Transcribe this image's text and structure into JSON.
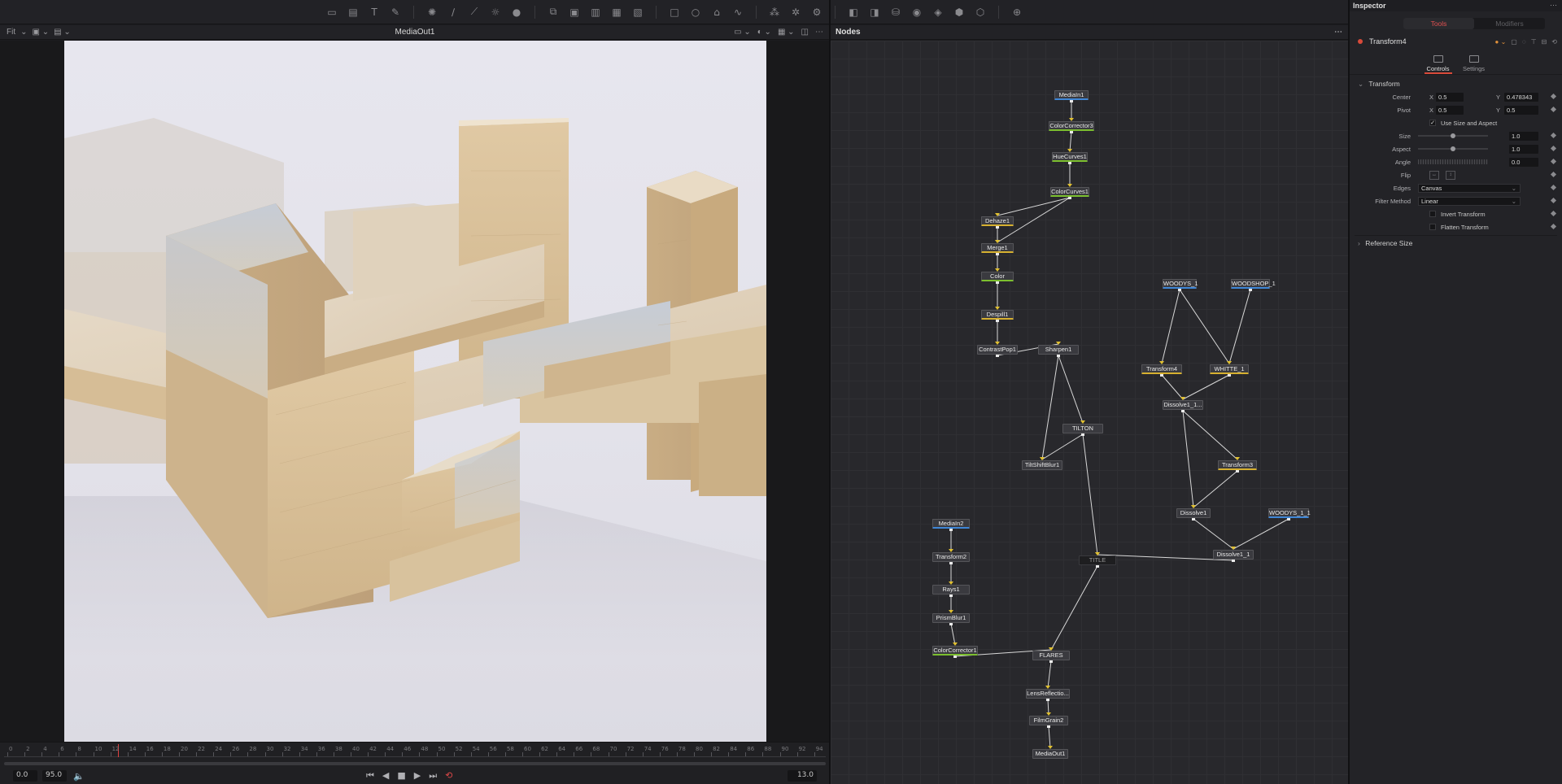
{
  "viewer": {
    "fit_label": "Fit",
    "title": "MediaOut1"
  },
  "timeline": {
    "ticks": [
      "0",
      "2",
      "4",
      "6",
      "8",
      "10",
      "12",
      "14",
      "16",
      "18",
      "20",
      "22",
      "24",
      "26",
      "28",
      "30",
      "32",
      "34",
      "36",
      "38",
      "40",
      "42",
      "44",
      "46",
      "48",
      "50",
      "52",
      "54",
      "56",
      "58",
      "60",
      "62",
      "64",
      "66",
      "68",
      "70",
      "72",
      "74",
      "76",
      "78",
      "80",
      "82",
      "84",
      "86",
      "88",
      "90",
      "92",
      "94"
    ],
    "start": "0.0",
    "end": "95.0",
    "current_frame": "13.0"
  },
  "nodes_panel": {
    "title": "Nodes",
    "nodes": [
      {
        "id": "MediaIn1",
        "label": "MediaIn1"
      },
      {
        "id": "ColorCorrector3",
        "label": "ColorCorrector3"
      },
      {
        "id": "HueCurves1",
        "label": "HueCurves1"
      },
      {
        "id": "ColorCurves1",
        "label": "ColorCurves1"
      },
      {
        "id": "Dehaze1",
        "label": "Dehaze1"
      },
      {
        "id": "Merge1",
        "label": "Merge1"
      },
      {
        "id": "Color",
        "label": "Color"
      },
      {
        "id": "Despill1",
        "label": "Despill1"
      },
      {
        "id": "ContrastPop1",
        "label": "ContrastPop1"
      },
      {
        "id": "Sharpen1",
        "label": "Sharpen1"
      },
      {
        "id": "TILTON",
        "label": "TILTON"
      },
      {
        "id": "TiltShiftBlur1",
        "label": "TiltShiftBlur1"
      },
      {
        "id": "WOODYS_1",
        "label": "WOODYS_1"
      },
      {
        "id": "WOODSHOP_1",
        "label": "WOODSHOP_1"
      },
      {
        "id": "Transform4",
        "label": "Transform4"
      },
      {
        "id": "WHITTE_1",
        "label": "WHITTE_1"
      },
      {
        "id": "Dissolve1_1_1",
        "label": "Dissolve1_1..."
      },
      {
        "id": "Transform3",
        "label": "Transform3"
      },
      {
        "id": "Dissolve1",
        "label": "Dissolve1"
      },
      {
        "id": "WOODYS_1_1",
        "label": "WOODYS_1_1"
      },
      {
        "id": "Dissolve1_1",
        "label": "Dissolve1_1"
      },
      {
        "id": "TITLE",
        "label": "TITLE"
      },
      {
        "id": "MediaIn2",
        "label": "MediaIn2"
      },
      {
        "id": "Transform2",
        "label": "Transform2"
      },
      {
        "id": "Rays1",
        "label": "Rays1"
      },
      {
        "id": "PrismBlur1",
        "label": "PrismBlur1"
      },
      {
        "id": "ColorCorrector1",
        "label": "ColorCorrector1"
      },
      {
        "id": "FLARES",
        "label": "FLARES"
      },
      {
        "id": "LensReflection",
        "label": "LensReflectio..."
      },
      {
        "id": "FilmGrain2",
        "label": "FilmGrain2"
      },
      {
        "id": "MediaOut1",
        "label": "MediaOut1"
      }
    ]
  },
  "inspector": {
    "title": "Inspector",
    "tabs": {
      "tools": "Tools",
      "modifiers": "Modifiers"
    },
    "tool_name": "Transform4",
    "subtabs": {
      "controls": "Controls",
      "settings": "Settings"
    },
    "section_transform": "Transform",
    "section_reference": "Reference Size",
    "center": {
      "label": "Center",
      "x_label": "X",
      "x": "0.5",
      "y_label": "Y",
      "y": "0.478343"
    },
    "pivot": {
      "label": "Pivot",
      "x_label": "X",
      "x": "0.5",
      "y_label": "Y",
      "y": "0.5"
    },
    "use_size_aspect": "Use Size and Aspect",
    "size": {
      "label": "Size",
      "value": "1.0",
      "level": 0.5
    },
    "aspect": {
      "label": "Aspect",
      "value": "1.0",
      "level": 0.5
    },
    "angle": {
      "label": "Angle",
      "value": "0.0"
    },
    "flip_label": "Flip",
    "edges": {
      "label": "Edges",
      "value": "Canvas"
    },
    "filter": {
      "label": "Filter Method",
      "value": "Linear"
    },
    "invert_transform": "Invert Transform",
    "flatten_transform": "Flatten Transform"
  },
  "colors": {
    "accent_red": "#d94a3a",
    "node_green": "#7cbf2f",
    "node_yellow": "#d6b030",
    "node_blue": "#3f86d6"
  }
}
